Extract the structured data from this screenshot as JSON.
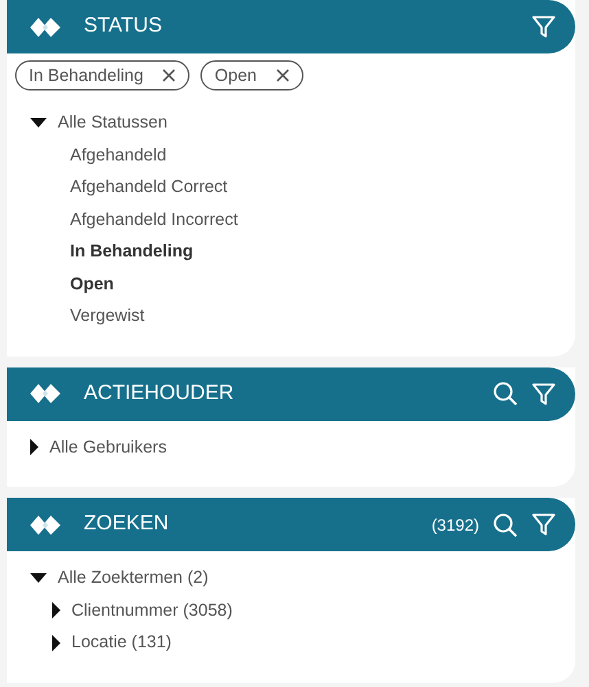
{
  "panels": [
    {
      "title": "STATUS",
      "searchable": false,
      "chips": [
        {
          "label": "In Behandeling"
        },
        {
          "label": "Open"
        }
      ],
      "tree": [
        {
          "label": "Alle Statussen",
          "expanded": true,
          "children": [
            {
              "label": "Afgehandeld",
              "selected": false
            },
            {
              "label": "Afgehandeld Correct",
              "selected": false
            },
            {
              "label": "Afgehandeld Incorrect",
              "selected": false
            },
            {
              "label": "In Behandeling",
              "selected": true
            },
            {
              "label": "Open",
              "selected": true
            },
            {
              "label": "Vergewist",
              "selected": false
            }
          ]
        }
      ]
    },
    {
      "title": "ACTIEHOUDER",
      "searchable": true,
      "tree": [
        {
          "label": "Alle Gebruikers",
          "expanded": false
        }
      ]
    },
    {
      "title": "ZOEKEN",
      "count": "(3192)",
      "searchable": true,
      "tree": [
        {
          "label": "Alle Zoektermen (2)",
          "expanded": true,
          "children": [
            {
              "label": "Clientnummer (3058)",
              "expanded": false
            },
            {
              "label": "Locatie (131)",
              "expanded": false
            }
          ]
        }
      ]
    }
  ]
}
